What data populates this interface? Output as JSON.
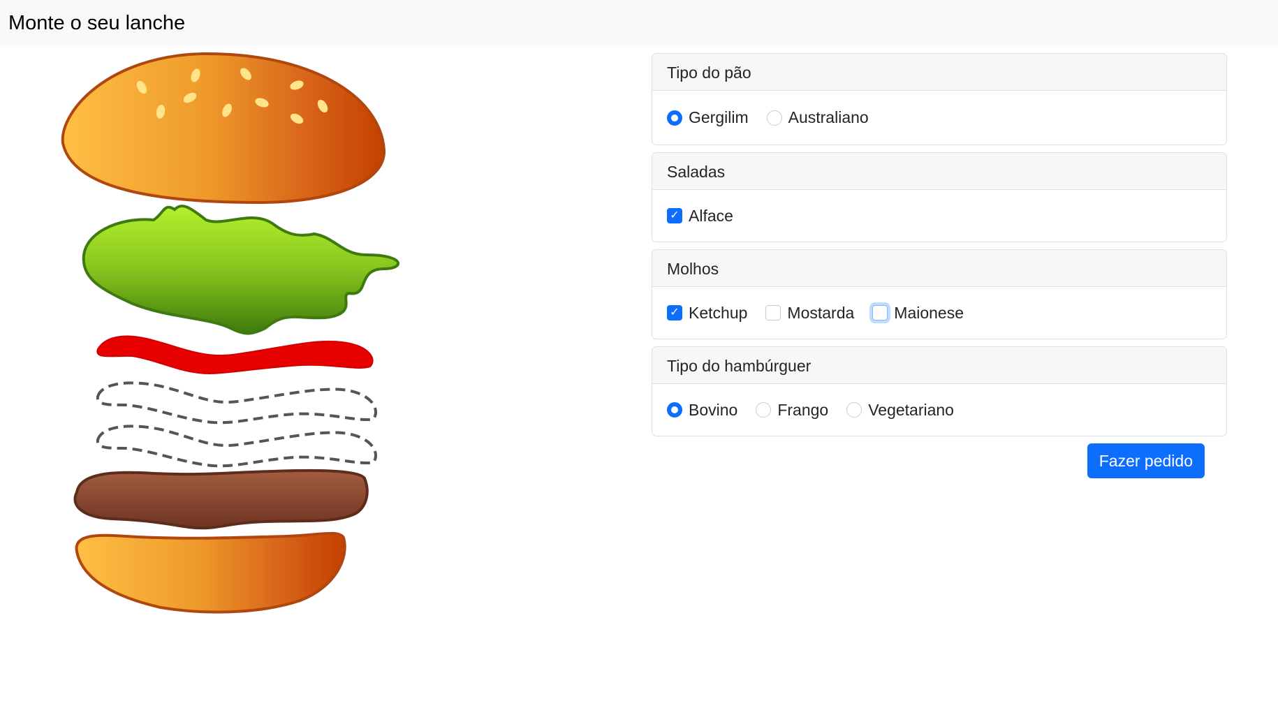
{
  "navbar": {
    "brand": "Monte o seu lanche"
  },
  "burger": {
    "layers": [
      "top-bun",
      "lettuce",
      "ketchup",
      "mustard-empty",
      "mayo-empty",
      "patty",
      "bottom-bun"
    ]
  },
  "form": {
    "bread": {
      "title": "Tipo do pão",
      "options": [
        {
          "label": "Gergilim",
          "selected": true
        },
        {
          "label": "Australiano",
          "selected": false
        }
      ]
    },
    "salads": {
      "title": "Saladas",
      "options": [
        {
          "label": "Alface",
          "checked": true
        }
      ]
    },
    "sauces": {
      "title": "Molhos",
      "options": [
        {
          "label": "Ketchup",
          "checked": true
        },
        {
          "label": "Mostarda",
          "checked": false
        },
        {
          "label": "Maionese",
          "checked": false
        }
      ]
    },
    "patty": {
      "title": "Tipo do hambúrguer",
      "options": [
        {
          "label": "Bovino",
          "selected": true
        },
        {
          "label": "Frango",
          "selected": false
        },
        {
          "label": "Vegetariano",
          "selected": false
        }
      ]
    },
    "submit_label": "Fazer pedido"
  },
  "colors": {
    "primary": "#0d6efd",
    "navbar_bg": "#f8f9fa",
    "bun_light": "#ffbe44",
    "bun_dark": "#c84000",
    "lettuce": "#8ccf1c",
    "ketchup": "#e60000",
    "patty": "#8a4a32"
  }
}
